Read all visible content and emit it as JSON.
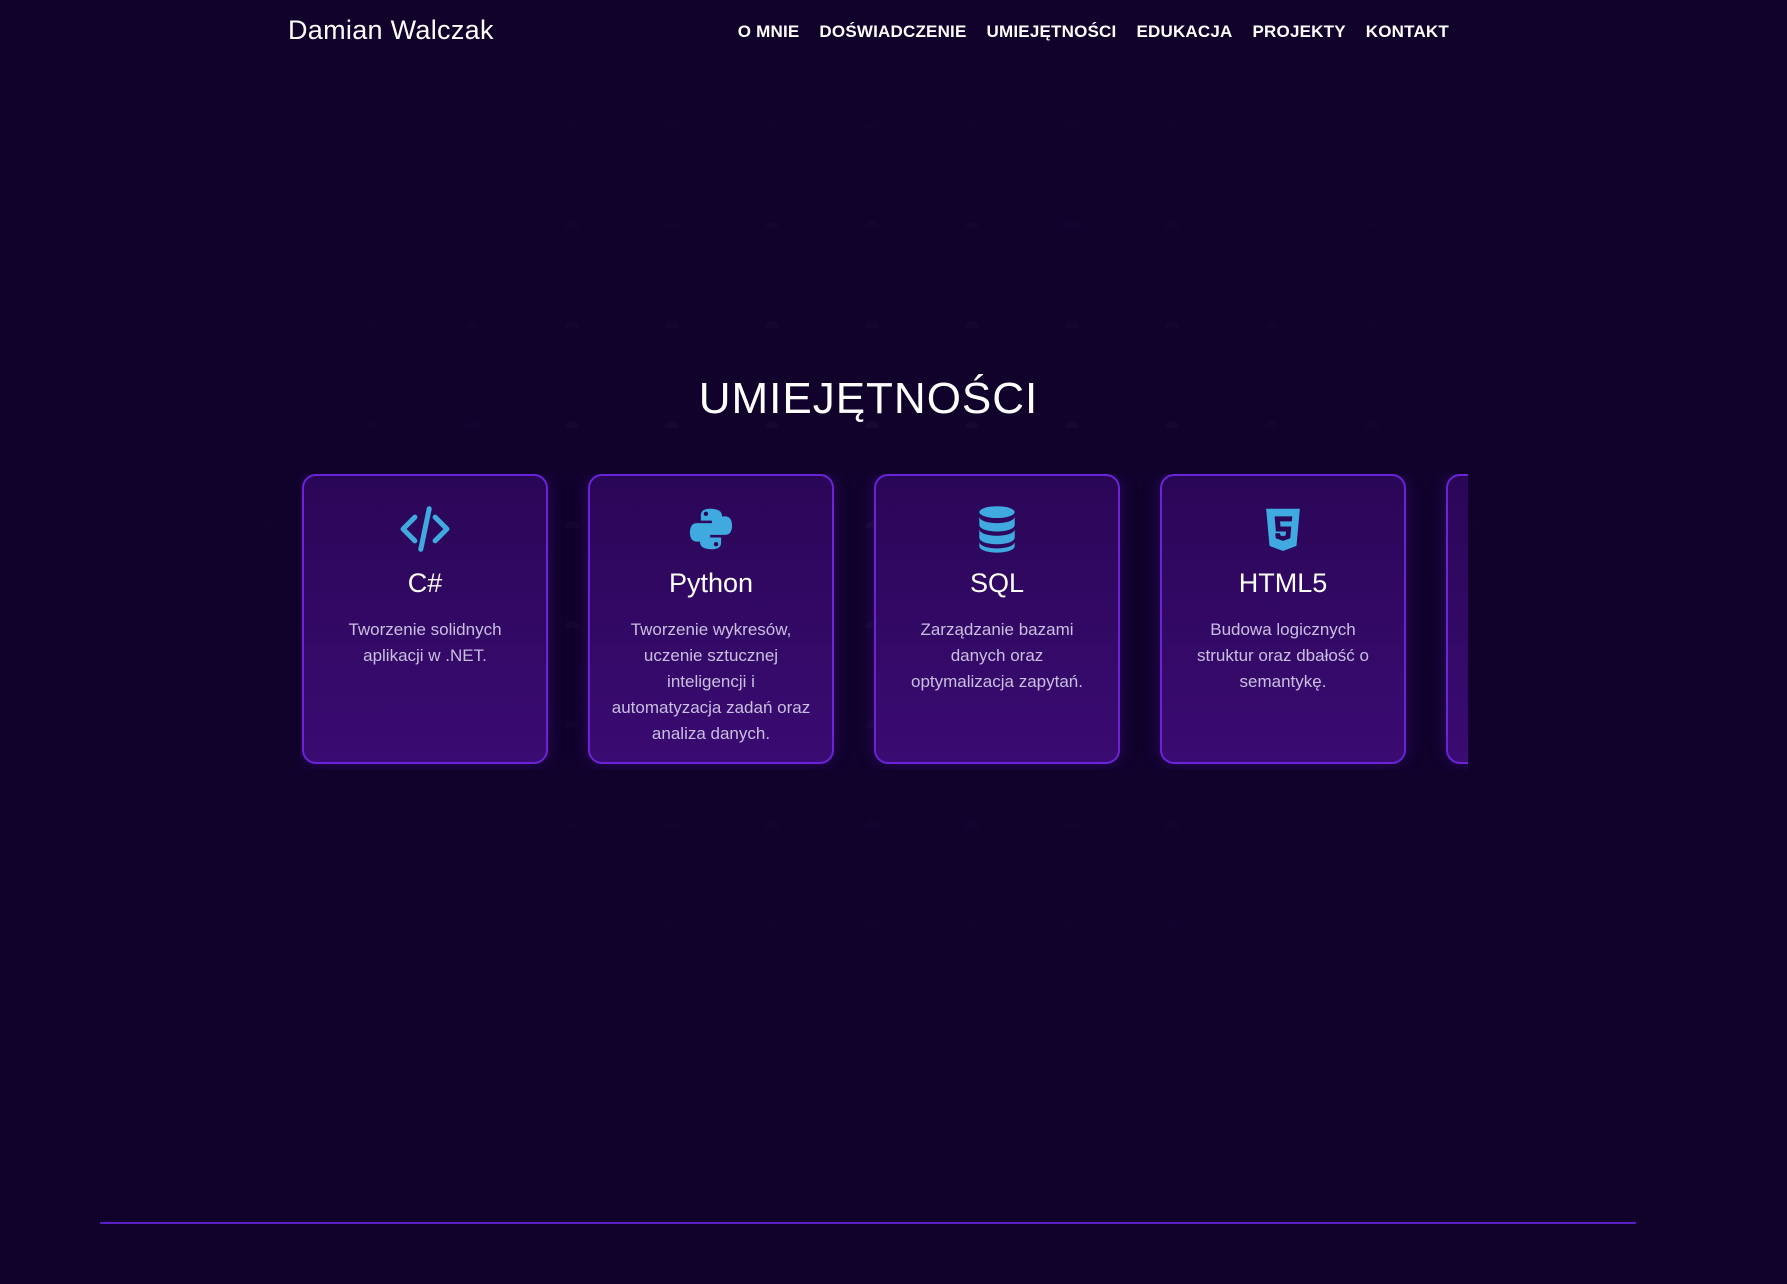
{
  "navbar": {
    "brand": "Damian Walczak",
    "links": [
      {
        "label": "O MNIE"
      },
      {
        "label": "DOŚWIADCZENIE"
      },
      {
        "label": "UMIEJĘTNOŚCI"
      },
      {
        "label": "EDUKACJA"
      },
      {
        "label": "PROJEKTY"
      },
      {
        "label": "KONTAKT"
      }
    ]
  },
  "skills": {
    "title": "UMIEJĘTNOŚCI",
    "cards": [
      {
        "icon": "code-icon",
        "title": "C#",
        "description": "Tworzenie solidnych aplikacji w .NET."
      },
      {
        "icon": "python-icon",
        "title": "Python",
        "description": "Tworzenie wykresów, uczenie sztucznej inteligencji i automatyzacja zadań oraz analiza danych."
      },
      {
        "icon": "database-icon",
        "title": "SQL",
        "description": "Zarządzanie bazami danych oraz optymalizacja zapytań."
      },
      {
        "icon": "html5-icon",
        "title": "HTML5",
        "description": "Budowa logicznych struktur oraz dbałość o semantykę."
      }
    ]
  },
  "colors": {
    "background": "#10022b",
    "card_border": "#6a23d8",
    "icon": "#3fa9e0",
    "accent_line": "#5a1fc4"
  }
}
